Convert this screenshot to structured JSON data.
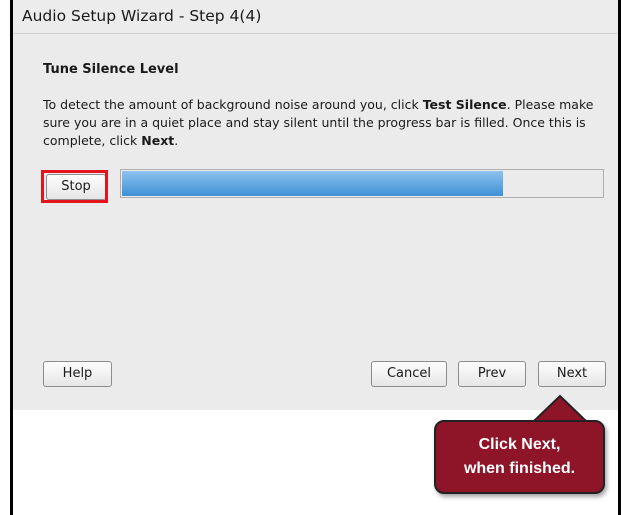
{
  "window": {
    "title": "Audio Setup Wizard - Step 4(4)"
  },
  "step": {
    "heading": "Tune Silence Level",
    "instructions": {
      "part1": "To detect the amount of background noise around you, click ",
      "test_silence": "Test Silence",
      "part2": ". Please make sure you are in a quiet place and stay silent until the progress bar is filled. Once this is complete, click ",
      "next": "Next",
      "part3": "."
    },
    "stop_label": "Stop",
    "progress_fraction": 0.793
  },
  "footer": {
    "help_label": "Help",
    "cancel_label": "Cancel",
    "prev_label": "Prev",
    "next_label": "Next"
  },
  "callout": {
    "line1": "Click Next,",
    "line2": "when finished."
  },
  "colors": {
    "progress_fill": "#4a9be0",
    "highlight_border": "#e3141b",
    "callout_background": "#8e1428"
  }
}
